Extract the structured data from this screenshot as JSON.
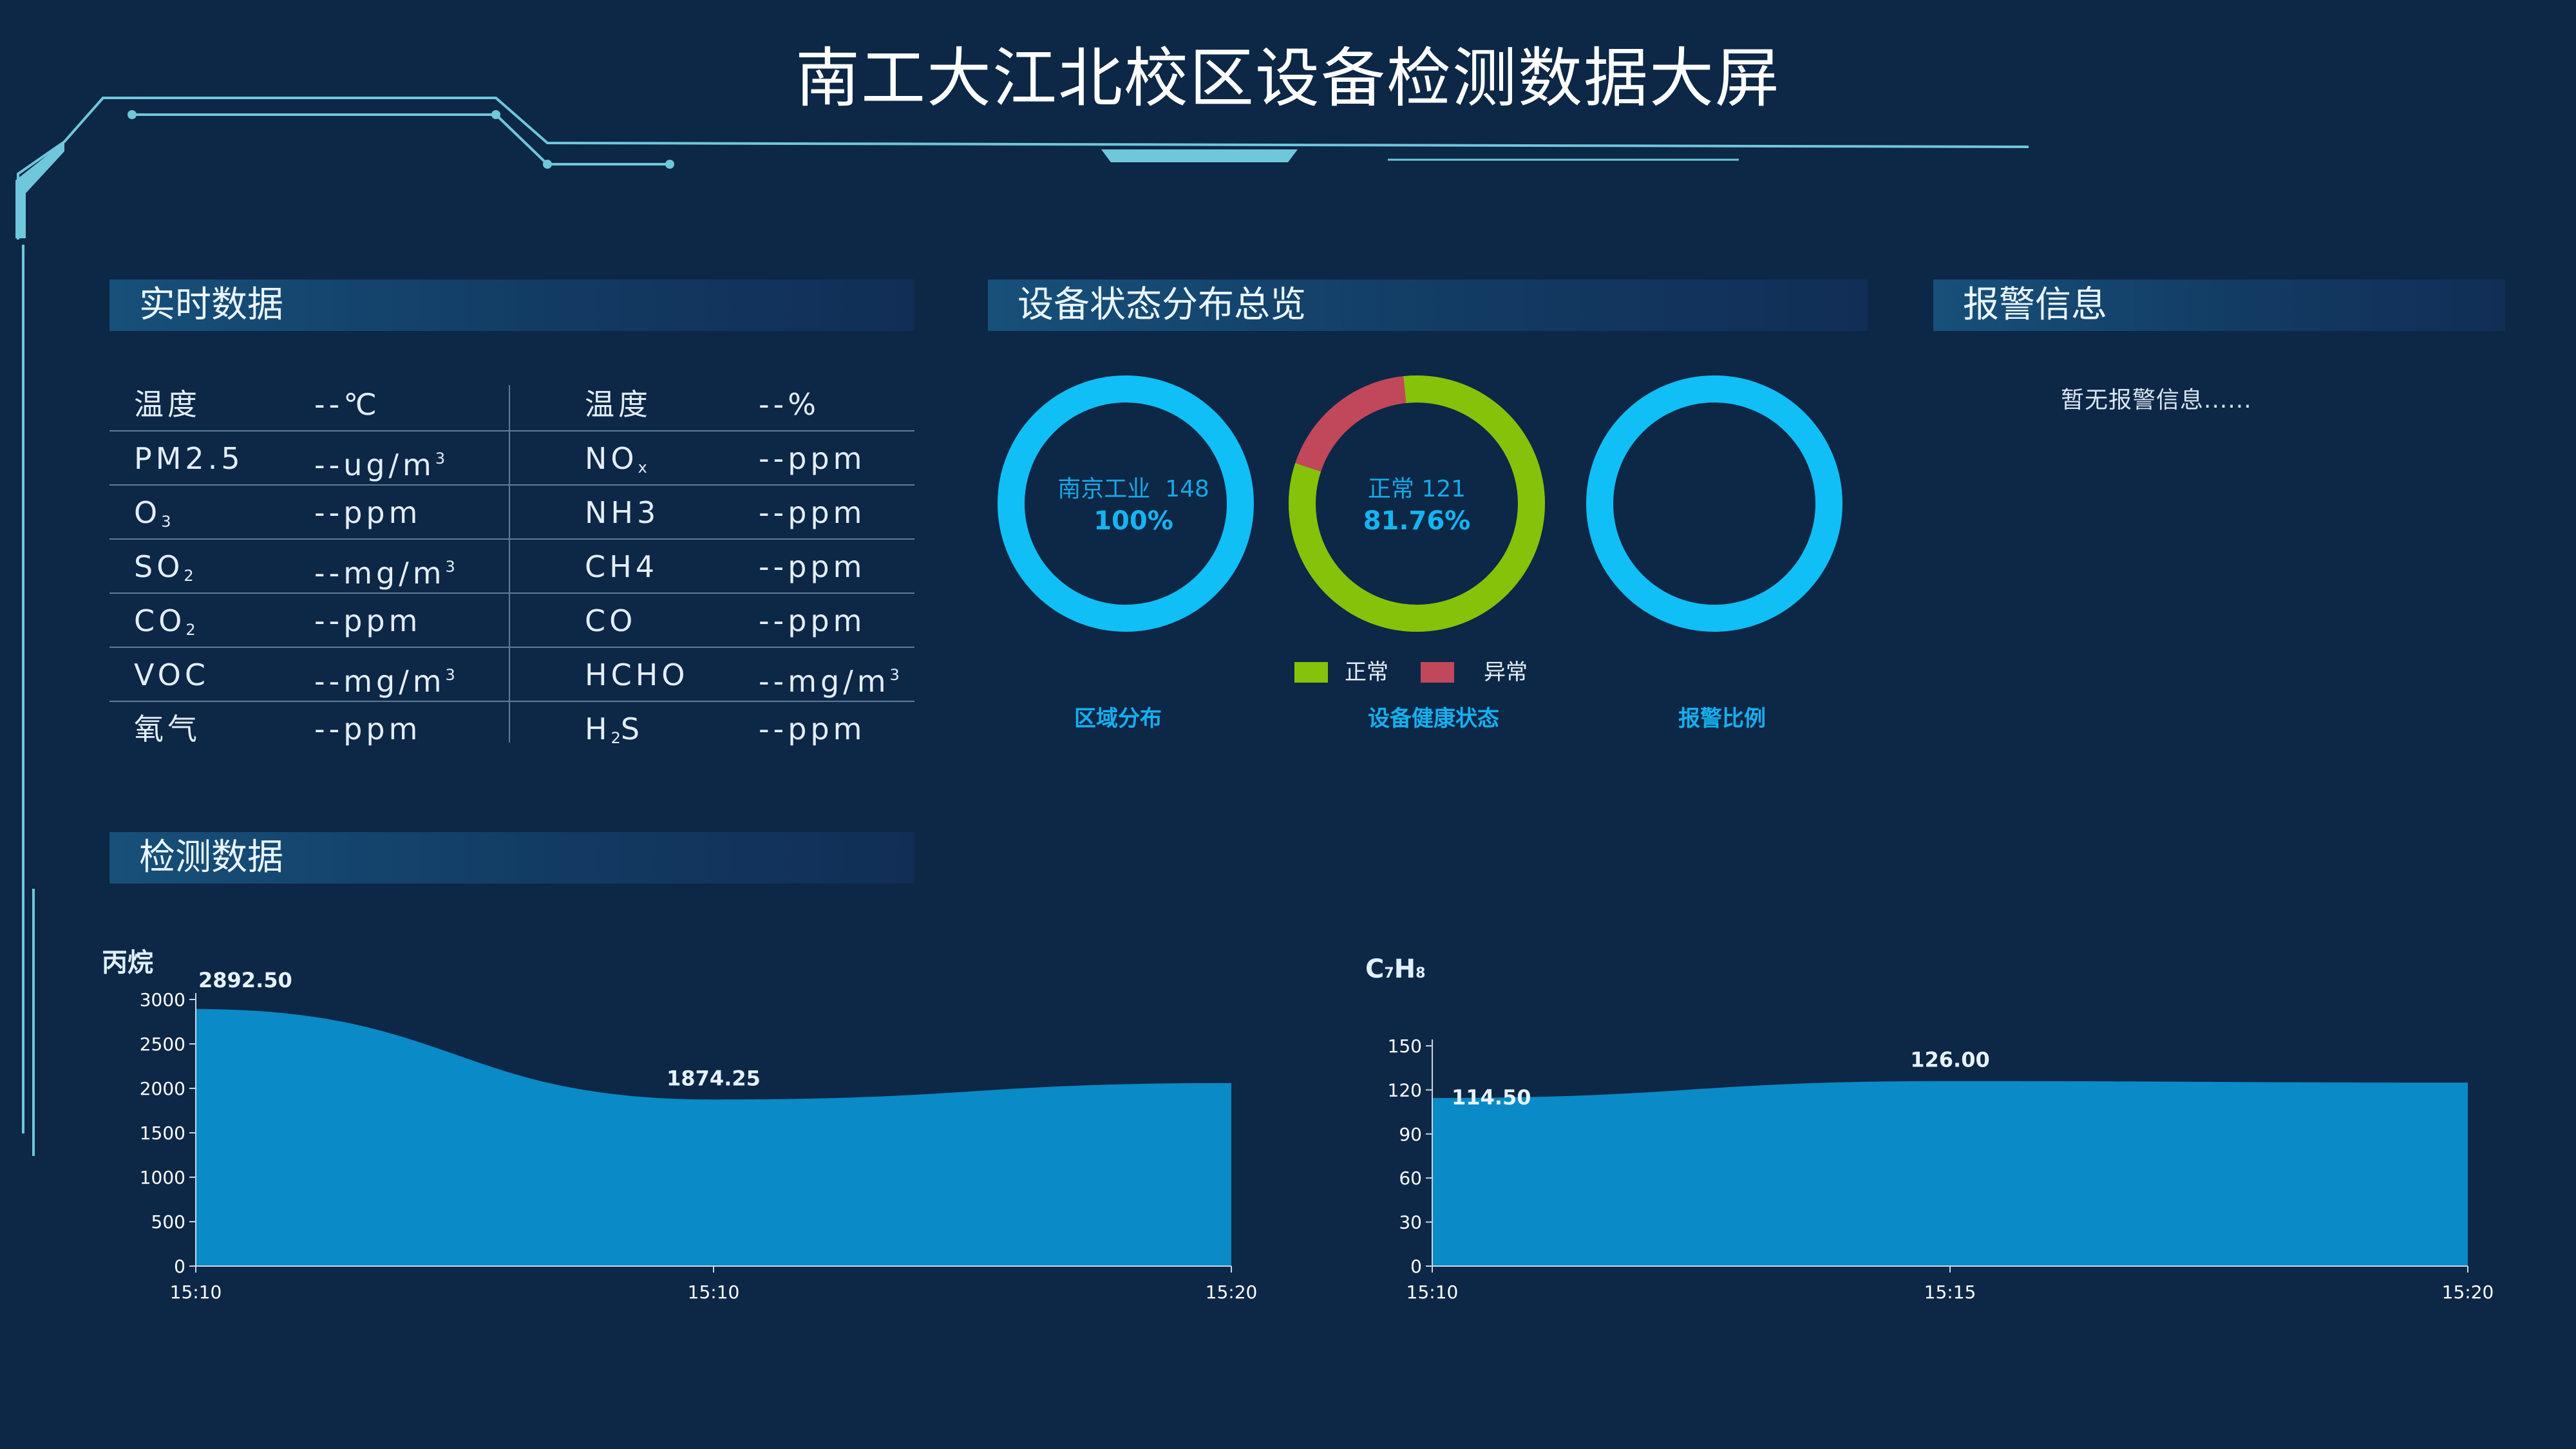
{
  "title": "南工大江北校区设备检测数据大屏",
  "realtime": {
    "header": "实时数据",
    "rows": [
      {
        "l_name": "温度",
        "l_value": "--℃",
        "r_name": "温度",
        "r_value": "--%"
      },
      {
        "l_name": "PM2.5",
        "l_value": "--ug/m",
        "l_sup": "3",
        "r_name": "NO",
        "r_sub": "x",
        "r_value": "--ppm"
      },
      {
        "l_name": "O",
        "l_sub": "3",
        "l_value": "--ppm",
        "r_name": "NH3",
        "r_value": "--ppm"
      },
      {
        "l_name": "SO",
        "l_sub": "2",
        "l_value": "--mg/m",
        "l_sup": "3",
        "r_name": "CH4",
        "r_value": "--ppm"
      },
      {
        "l_name": "CO",
        "l_sub": "2",
        "l_value": "--ppm",
        "r_name": "CO",
        "r_value": "--ppm"
      },
      {
        "l_name": "VOC",
        "l_value": "--mg/m",
        "l_sup": "3",
        "r_name": "HCHO",
        "r_value": "--mg/m",
        "r_sup": "3"
      },
      {
        "l_name": "氧气",
        "l_value": "--ppm",
        "r_name": "H",
        "r_sub": "2",
        "r_name2": "S",
        "r_value": "--ppm"
      }
    ]
  },
  "status": {
    "header": "设备状态分布总览",
    "region": {
      "name": "南京工业",
      "count": "148",
      "percent": "100%",
      "fraction": 1.0,
      "caption": "区域分布",
      "color": "#10bff5"
    },
    "health": {
      "name": "正常",
      "count": "121",
      "percent": "81.76%",
      "normal_fraction": 0.8176,
      "caption": "设备健康状态",
      "normal_color": "#86c20a",
      "abnormal_color": "#c1485a"
    },
    "alarm_ratio": {
      "caption": "报警比例",
      "color": "#10bff5"
    },
    "legend": [
      {
        "label": "正常",
        "color": "#86c20a"
      },
      {
        "label": "异常",
        "color": "#c1485a"
      }
    ]
  },
  "alarm": {
    "header": "报警信息",
    "empty_text": "暂无报警信息......"
  },
  "detection": {
    "header": "检测数据"
  },
  "chart_data": [
    {
      "type": "area",
      "title": "丙烷",
      "x": [
        "15:10",
        "15:10",
        "15:20"
      ],
      "y": [
        2892.5,
        1874.25,
        2060.0
      ],
      "point_labels": [
        "2892.50",
        "1874.25",
        ""
      ],
      "yticks": [
        0,
        500,
        1000,
        1500,
        2000,
        2500,
        3000
      ],
      "ylim": [
        0,
        3000
      ],
      "color": "#0a8ac6"
    },
    {
      "type": "area",
      "title": "C7H8",
      "title_parts": {
        "c": "C",
        "c_sub": "7",
        "h": "H",
        "h_sub": "8"
      },
      "x": [
        "15:10",
        "15:15",
        "15:20"
      ],
      "y": [
        114.5,
        126.0,
        125.0
      ],
      "point_labels": [
        "114.50",
        "126.00",
        ""
      ],
      "yticks": [
        0,
        30,
        60,
        90,
        120,
        150
      ],
      "ylim": [
        0,
        150
      ],
      "color": "#0a8ac6"
    }
  ]
}
